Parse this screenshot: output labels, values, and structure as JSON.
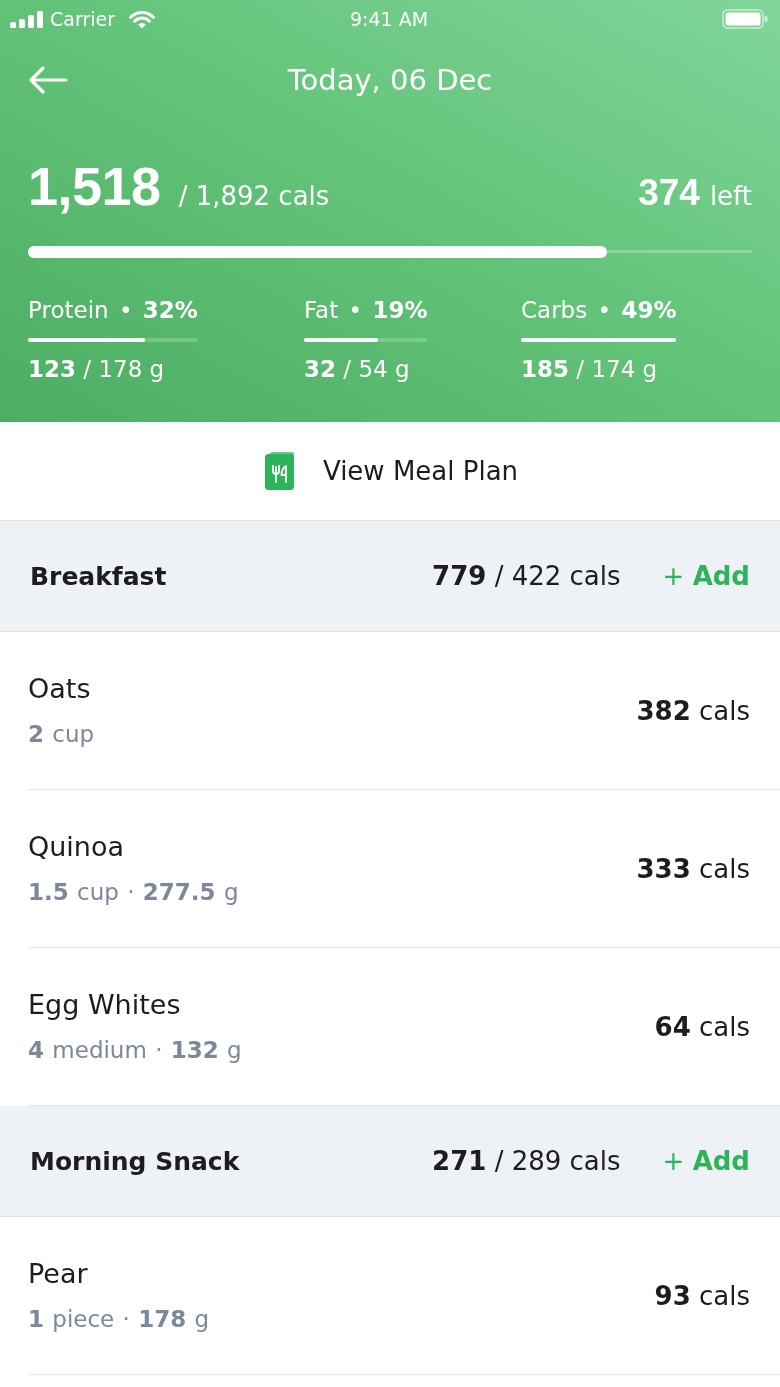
{
  "status_bar": {
    "carrier": "Carrier",
    "time": "9:41 AM"
  },
  "header": {
    "title": "Today, 06 Dec"
  },
  "calories": {
    "consumed": "1,518",
    "goal": "/ 1,892 cals",
    "remaining": "374",
    "remaining_label": "left",
    "level": 0.8
  },
  "macros": [
    {
      "label": "Protein • **32%**",
      "amount": "**123** / 178 g",
      "level": 0.69
    },
    {
      "label": "Fat • **19%**",
      "amount": "**32** / 54 g",
      "level": 0.6
    },
    {
      "label": "Carbs • **49%**",
      "amount": "**185** / 174 g",
      "level": 1
    }
  ],
  "meal_plan_link": {
    "label": "View Meal Plan"
  },
  "meals": [
    {
      "name": "Breakfast",
      "total": "**779** / 422 cals",
      "add_label": "+ **Add**",
      "foods": [
        {
          "name": "Oats",
          "portion": "**2** cup",
          "calories": "**382** cals"
        },
        {
          "name": "Quinoa",
          "portion": "**1.5** cup · **277.5** g",
          "calories": "**333** cals"
        },
        {
          "name": "Egg Whites",
          "portion": "**4** medium · **132** g",
          "calories": "**64** cals"
        }
      ]
    },
    {
      "name": "Morning Snack",
      "total": "**271** / 289 cals",
      "add_label": "+ **Add**",
      "foods": [
        {
          "name": "Pear",
          "portion": "**1** piece · **178** g",
          "calories": "**93** cals"
        }
      ]
    }
  ]
}
